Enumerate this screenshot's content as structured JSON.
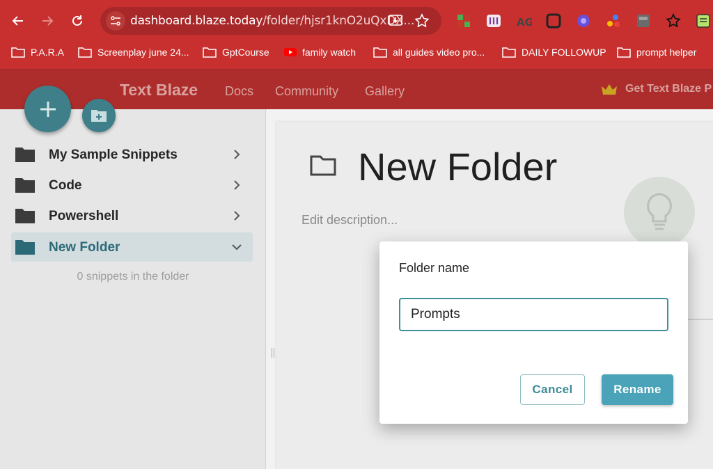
{
  "browser": {
    "url_host": "dashboard.blaze.today",
    "url_path": "/folder/hjsr1knO2uQxDX...",
    "bookmarks": [
      {
        "label": "P.A.R.A",
        "icon": "folder-icon"
      },
      {
        "label": "Screenplay june 24...",
        "icon": "folder-icon"
      },
      {
        "label": "GptCourse",
        "icon": "folder-icon"
      },
      {
        "label": "family watch",
        "icon": "youtube-icon"
      },
      {
        "label": "all guides video pro...",
        "icon": "folder-icon"
      },
      {
        "label": "DAILY FOLLOWUP",
        "icon": "folder-icon"
      },
      {
        "label": "prompt helper",
        "icon": "folder-icon"
      }
    ],
    "colors": {
      "chrome": "#c8302f",
      "omnibox": "#a8282a"
    }
  },
  "app": {
    "brand": "Text Blaze",
    "nav": [
      "Docs",
      "Community",
      "Gallery"
    ],
    "get_pro": "Get Text Blaze P",
    "accent": "#3f7f89"
  },
  "sidebar": {
    "folders": [
      {
        "name": "My Sample Snippets",
        "expanded": false
      },
      {
        "name": "Code",
        "expanded": false
      },
      {
        "name": "Powershell",
        "expanded": false
      },
      {
        "name": "New Folder",
        "expanded": true,
        "selected": true
      }
    ],
    "empty_message": "0 snippets in the folder"
  },
  "main": {
    "title": "New Folder",
    "description_placeholder": "Edit description..."
  },
  "dialog": {
    "title": "Folder name",
    "input_value": "Prompts",
    "cancel_label": "Cancel",
    "rename_label": "Rename",
    "primary_color": "#4aa3b8"
  }
}
